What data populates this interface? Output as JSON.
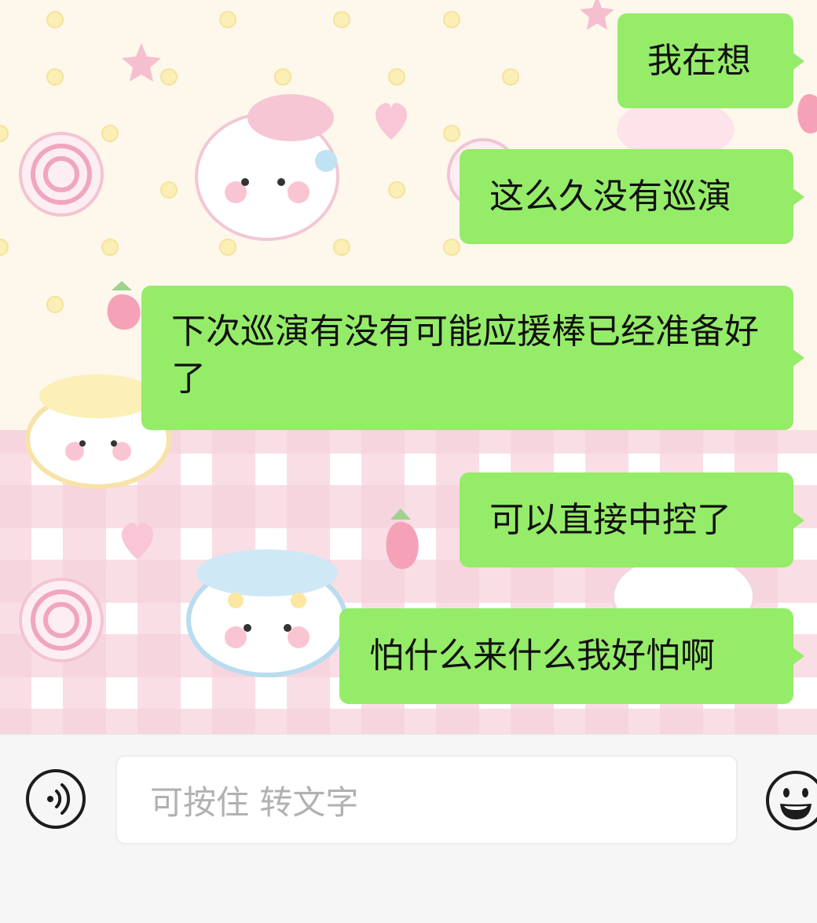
{
  "chat": {
    "messages": [
      {
        "side": "right",
        "text": "我在想"
      },
      {
        "side": "right",
        "text": "这么久没有巡演"
      },
      {
        "side": "right",
        "text": "下次巡演有没有可能应援棒已经准备好了"
      },
      {
        "side": "right",
        "text": "可以直接中控了"
      },
      {
        "side": "right",
        "text": "怕什么来什么我好怕啊"
      }
    ]
  },
  "input_bar": {
    "voice_icon": "voice-icon",
    "placeholder": "可按住 转文字",
    "emoji_icon": "emoji-icon"
  },
  "colors": {
    "bubble": "#95ec69",
    "input_bar_bg": "#f6f6f6",
    "placeholder_text": "#b1b1b1"
  }
}
